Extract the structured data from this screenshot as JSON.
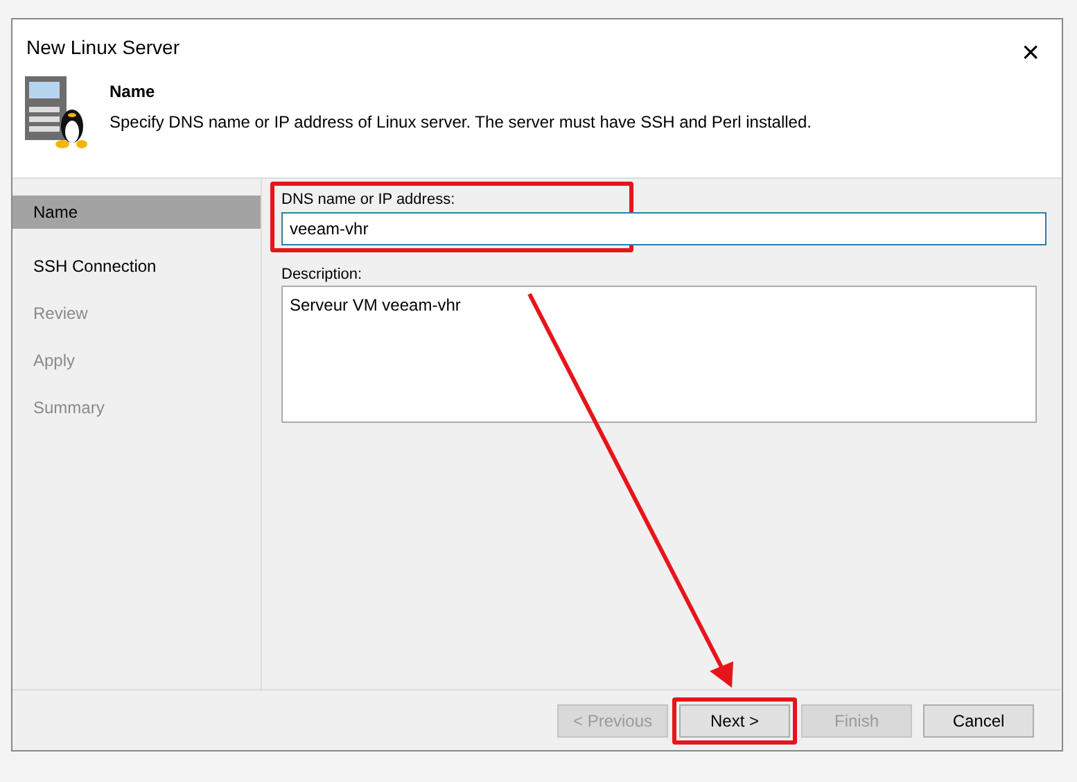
{
  "window": {
    "title": "New Linux Server",
    "close": "×"
  },
  "header": {
    "title": "Name",
    "description": "Specify DNS name or IP address of Linux server. The server must have SSH and Perl installed."
  },
  "steps": [
    {
      "label": "Name",
      "selected": true,
      "disabled": false
    },
    {
      "label": "SSH Connection",
      "selected": false,
      "disabled": false
    },
    {
      "label": "Review",
      "selected": false,
      "disabled": true
    },
    {
      "label": "Apply",
      "selected": false,
      "disabled": true
    },
    {
      "label": "Summary",
      "selected": false,
      "disabled": true
    }
  ],
  "form": {
    "dns_label": "DNS name or IP address:",
    "dns_value": "veeam-vhr",
    "description_label": "Description:",
    "description_value": "Serveur VM veeam-vhr"
  },
  "buttons": [
    {
      "label": "< Previous",
      "disabled": true,
      "highlighted": false
    },
    {
      "label": "Next >",
      "disabled": false,
      "highlighted": true
    },
    {
      "label": "Finish",
      "disabled": true,
      "highlighted": false
    },
    {
      "label": "Cancel",
      "disabled": false,
      "highlighted": false
    }
  ],
  "annotations": {
    "field_frame": true,
    "arrow": true
  }
}
